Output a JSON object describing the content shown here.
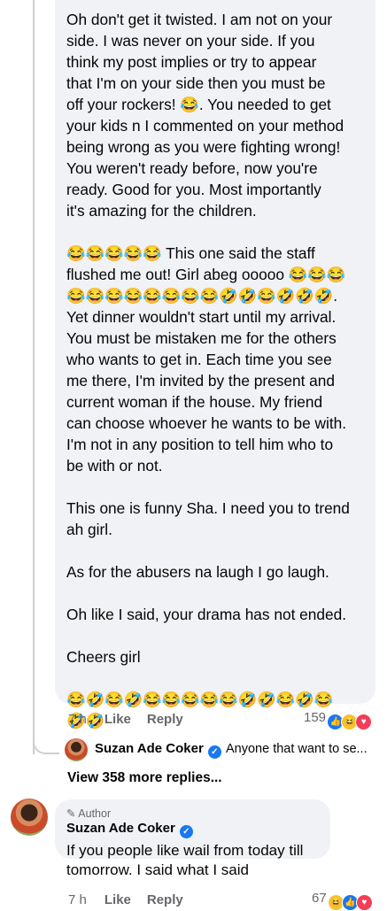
{
  "main_comment": {
    "paragraphs": [
      "Oh don't get it twisted. I am not on your\nside. I was never on your side. If you\nthink my post implies or try to appear\nthat I'm on your side then you must be\noff your rockers! 😂. You needed to get\nyour kids n I commented on your method\nbeing wrong as you were fighting wrong!\nYou weren't ready before, now you're\nready. Good for you. Most importantly\nit's amazing for the children.",
      "😂😂😂😂😂 This one said the staff\nflushed me out! Girl abeg ooooo 😂😂😂\n😂😂😂😂😂😂😂😂🤣🤣😂🤣🤣🤣.\nYet dinner wouldn't start until my arrival.\nYou must be mistaken me for the others\nwho wants to get in. Each time you see\nme there, I'm invited by the present and\ncurrent woman if the house. My friend\ncan choose whoever he wants to be with.\nI'm not in any position to tell him who to\nbe with or not.",
      "This one is funny Sha. I need you to trend\nah girl.",
      "As for the abusers na laugh I go laugh.",
      "Oh like I said, your drama has not ended.",
      "Cheers girl",
      "😂🤣😂🤣😂😂😂😂😂🤣🤣😂🤣😂\n🤣🤣"
    ],
    "time": "7 h",
    "like_label": "Like",
    "reply_label": "Reply",
    "reaction_count": "159"
  },
  "reply_preview": {
    "name": "Suzan Ade Coker",
    "text": "Anyone that want to se..."
  },
  "view_more": "View 358 more replies...",
  "author_comment": {
    "tag": "Author",
    "name": "Suzan Ade Coker",
    "text": "If you people like wail from today till\ntomorrow. I said what I said",
    "time": "7 h",
    "like_label": "Like",
    "reply_label": "Reply",
    "reaction_count": "67"
  },
  "colors": {
    "bubble": "#f0f2f5",
    "meta_text": "#65676b",
    "like_blue": "#1877f2",
    "love_red": "#f33e58",
    "haha_yellow": "#f7c22f"
  }
}
